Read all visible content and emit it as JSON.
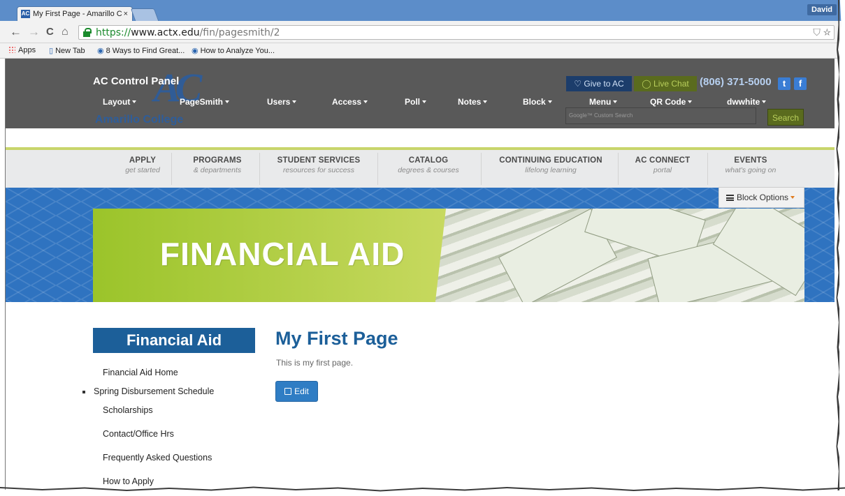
{
  "browser": {
    "tab_title": "My First Page - Amarillo C",
    "tab_close": "×",
    "favicon_text": "AC",
    "profile_name": "David",
    "url_scheme": "https://",
    "url_domain": "www.actx.edu",
    "url_path": "/fin/pagesmith/2",
    "nav_back": "←",
    "nav_forward": "→",
    "nav_reload": "C",
    "nav_home": "⌂",
    "omnibox_icons": "⛉ ☆",
    "toolbar_icons": "▭ ⊝"
  },
  "bookmarks": [
    {
      "label": "Apps",
      "icon": "apps-grid-icon"
    },
    {
      "label": "New Tab",
      "icon": "page-icon"
    },
    {
      "label": "8 Ways to Find Great...",
      "icon": "search-favicon"
    },
    {
      "label": "How to Analyze You...",
      "icon": "search-favicon"
    }
  ],
  "control_panel": {
    "title": "AC Control Panel",
    "college_name": "Amarillo College",
    "menu": [
      "Layout",
      "PageSmith",
      "Users",
      "Access",
      "Poll",
      "Notes",
      "Block",
      "Menu",
      "QR Code",
      "dwwhite"
    ],
    "give_label": "♡ Give to AC",
    "chat_label": "◯ Live Chat",
    "phone": "(806) 371-5000",
    "twitter": "t",
    "facebook": "f",
    "search_placeholder": "Google™ Custom Search",
    "search_label": "Search"
  },
  "site_nav": [
    {
      "main": "APPLY",
      "sub": "get started"
    },
    {
      "main": "PROGRAMS",
      "sub": "& departments"
    },
    {
      "main": "STUDENT SERVICES",
      "sub": "resources for success"
    },
    {
      "main": "CATALOG",
      "sub": "degrees & courses"
    },
    {
      "main": "CONTINUING EDUCATION",
      "sub": "lifelong learning"
    },
    {
      "main": "AC CONNECT",
      "sub": "portal"
    },
    {
      "main": "EVENTS",
      "sub": "what's going on"
    }
  ],
  "banner": {
    "block_options": "Block Options",
    "hero_title": "FINANCIAL AID"
  },
  "sidebar": {
    "heading": "Financial Aid",
    "links": [
      "Financial Aid Home",
      "Spring Disbursement Schedule",
      "Scholarships",
      "Contact/Office Hrs",
      "Frequently Asked Questions",
      "How to Apply"
    ]
  },
  "main": {
    "title": "My First Page",
    "body": "This is my first page.",
    "edit_label": "Edit"
  },
  "colors": {
    "browser_frame": "#5c8dc9",
    "control_panel_bg": "#595959",
    "college_blue": "#1c5f99",
    "accent_green": "#9bc42a",
    "banner_blue": "#2f73c0"
  }
}
